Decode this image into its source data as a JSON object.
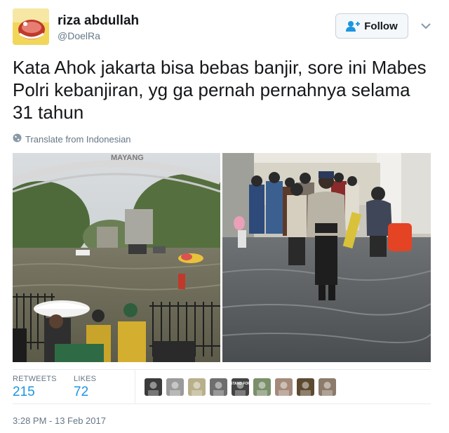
{
  "user": {
    "display_name": "riza abdullah",
    "handle": "@DoelRa",
    "avatar_icon": "avatar-image"
  },
  "follow_button": {
    "label": "Follow",
    "icon": "add-user-icon"
  },
  "more_menu_icon": "chevron-down-icon",
  "tweet": {
    "text": "Kata Ahok jakarta bisa bebas banjir, sore ini Mabes Polri kebanjiran, yg ga pernah pernahnya selama 31 tahun",
    "translate_label": "Translate from Indonesian",
    "translate_icon": "globe-icon"
  },
  "media": {
    "photos": [
      {
        "subject": "flooded-gate-photo",
        "arch_text": "MAYANG"
      },
      {
        "subject": "police-wading-photo"
      }
    ]
  },
  "stats": {
    "retweets_label": "RETWEETS",
    "retweets_value": "215",
    "likes_label": "LIKES",
    "likes_value": "72",
    "likers": [
      {
        "name": "liker-avatar-1",
        "color": "#3b3b3b"
      },
      {
        "name": "liker-avatar-2",
        "color": "#9a9a9a"
      },
      {
        "name": "liker-avatar-3",
        "color": "#b8b08a"
      },
      {
        "name": "liker-avatar-4",
        "color": "#6e6e6e"
      },
      {
        "name": "liker-avatar-5",
        "color": "#444444",
        "text": "STAND FOR"
      },
      {
        "name": "liker-avatar-6",
        "color": "#7a8f6a"
      },
      {
        "name": "liker-avatar-7",
        "color": "#a48a7a"
      },
      {
        "name": "liker-avatar-8",
        "color": "#5c4a30"
      },
      {
        "name": "liker-avatar-9",
        "color": "#8c7a6a"
      }
    ]
  },
  "timestamp": "3:28 PM - 13 Feb 2017",
  "colors": {
    "link_blue": "#1b95e0",
    "muted_gray": "#657786",
    "text_dark": "#14171a",
    "border": "#e6ecf0"
  }
}
